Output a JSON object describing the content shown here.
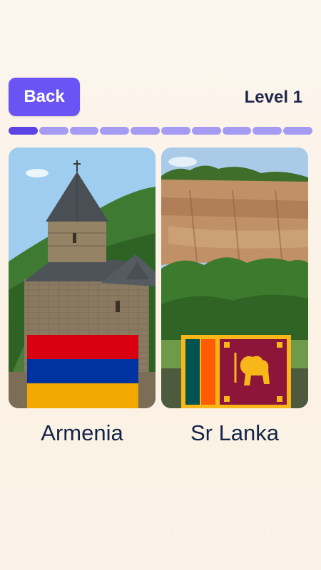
{
  "header": {
    "back_label": "Back",
    "level_label": "Level 1"
  },
  "progress": {
    "segments_total": 10,
    "segments_completed": 1,
    "colors": {
      "completed": "#5b44e3",
      "pending": "#a59bf3"
    }
  },
  "options": [
    {
      "name": "Armenia",
      "flag": "armenia-flag",
      "photo": "armenian-church-photo"
    },
    {
      "name": "Sr Lanka",
      "flag": "sri-lanka-flag",
      "photo": "sigiriya-rock-photo"
    }
  ],
  "colors": {
    "accent": "#6b54f5",
    "text": "#142447"
  }
}
